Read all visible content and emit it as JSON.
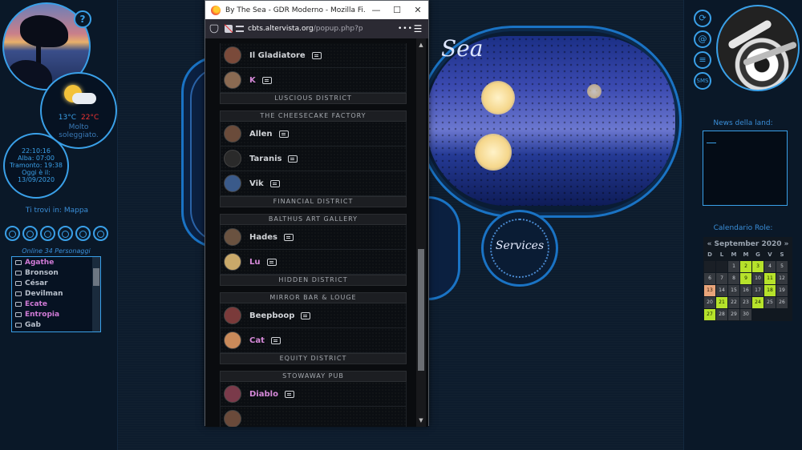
{
  "left": {
    "weather": {
      "temp_min": "13°C",
      "temp_max": "22°C",
      "description_line1": "Molto",
      "description_line2": "soleggiato."
    },
    "clock": {
      "time": "22:10:16",
      "sunrise": "Alba: 07:00",
      "sunset": "Tramonto: 19:38",
      "today_label": "Oggi è il:",
      "date": "13/09/2020"
    },
    "location": "Ti trovi in: Mappa",
    "online_title": "Online 34 Personaggi",
    "online": [
      {
        "name": "Agathe",
        "color": "pink"
      },
      {
        "name": "Bronson",
        "color": "grey"
      },
      {
        "name": "César",
        "color": "grey"
      },
      {
        "name": "Devilman",
        "color": "grey"
      },
      {
        "name": "Ecate",
        "color": "pink"
      },
      {
        "name": "Entropia",
        "color": "pink"
      },
      {
        "name": "Gab",
        "color": "grey"
      }
    ],
    "icons": [
      "map-pin-icon",
      "people-icon",
      "group-icon",
      "chat-icon",
      "mail-icon",
      "power-icon"
    ]
  },
  "right": {
    "icons": [
      "refresh-icon",
      "at-icon",
      "list-icon",
      "sms-icon"
    ],
    "sms_label": "SMS",
    "news_title": "News della land:",
    "calendar_title": "Calendario Role:",
    "calendar": {
      "header": "« September 2020 »",
      "day_names": [
        "D",
        "L",
        "M",
        "M",
        "G",
        "V",
        "S"
      ],
      "cells": [
        {
          "d": "",
          "s": "empty"
        },
        {
          "d": "",
          "s": "empty"
        },
        {
          "d": "1",
          "s": "n"
        },
        {
          "d": "2",
          "s": "green"
        },
        {
          "d": "3",
          "s": "green"
        },
        {
          "d": "4",
          "s": "n"
        },
        {
          "d": "5",
          "s": "n"
        },
        {
          "d": "6",
          "s": "n"
        },
        {
          "d": "7",
          "s": "n"
        },
        {
          "d": "8",
          "s": "n"
        },
        {
          "d": "9",
          "s": "green"
        },
        {
          "d": "10",
          "s": "n"
        },
        {
          "d": "11",
          "s": "green"
        },
        {
          "d": "12",
          "s": "n"
        },
        {
          "d": "13",
          "s": "today"
        },
        {
          "d": "14",
          "s": "n"
        },
        {
          "d": "15",
          "s": "n"
        },
        {
          "d": "16",
          "s": "n"
        },
        {
          "d": "17",
          "s": "n"
        },
        {
          "d": "18",
          "s": "green"
        },
        {
          "d": "19",
          "s": "n"
        },
        {
          "d": "20",
          "s": "n"
        },
        {
          "d": "21",
          "s": "green"
        },
        {
          "d": "22",
          "s": "n"
        },
        {
          "d": "23",
          "s": "n"
        },
        {
          "d": "24",
          "s": "green"
        },
        {
          "d": "25",
          "s": "n"
        },
        {
          "d": "26",
          "s": "n"
        },
        {
          "d": "27",
          "s": "green"
        },
        {
          "d": "28",
          "s": "n"
        },
        {
          "d": "29",
          "s": "n"
        },
        {
          "d": "30",
          "s": "n"
        },
        {
          "d": "",
          "s": "blank"
        },
        {
          "d": "",
          "s": "blank"
        },
        {
          "d": "",
          "s": "blank"
        }
      ]
    }
  },
  "center": {
    "brand_fragment": "Sea",
    "services_label": "Services"
  },
  "popup": {
    "title": "By The Sea - GDR Moderno - Mozilla Fi...",
    "url_domain": "cbts.altervista.org",
    "url_path": "/popup.php?p",
    "sections": [
      {
        "type": "rows",
        "rows": [
          {
            "name": "Il Gladiatore",
            "color": "grey",
            "avatar": "#7a4a3a"
          },
          {
            "name": "K",
            "color": "pink",
            "avatar": "#8a6a52"
          }
        ]
      },
      {
        "type": "header",
        "label": "LUSCIOUS DISTRICT"
      },
      {
        "type": "gap"
      },
      {
        "type": "header",
        "label": "THE CHEESECAKE FACTORY"
      },
      {
        "type": "rows",
        "rows": [
          {
            "name": "Allen",
            "color": "grey",
            "avatar": "#6a4b3a"
          },
          {
            "name": "Taranis",
            "color": "grey",
            "avatar": "#2a2a2a"
          },
          {
            "name": "Vik",
            "color": "grey",
            "avatar": "#3a5a8a"
          }
        ]
      },
      {
        "type": "header",
        "label": "FINANCIAL DISTRICT"
      },
      {
        "type": "gap"
      },
      {
        "type": "header",
        "label": "BALTHUS ART GALLERY"
      },
      {
        "type": "rows",
        "rows": [
          {
            "name": "Hades",
            "color": "grey",
            "avatar": "#6a5240"
          },
          {
            "name": "Lu",
            "color": "pink",
            "avatar": "#c9a96a"
          }
        ]
      },
      {
        "type": "header",
        "label": "HIDDEN DISTRICT"
      },
      {
        "type": "gap"
      },
      {
        "type": "header",
        "label": "MIRROR BAR & LOUGE"
      },
      {
        "type": "rows",
        "rows": [
          {
            "name": "Beepboop",
            "color": "grey",
            "avatar": "#7a3a3a"
          },
          {
            "name": "Cat",
            "color": "pink",
            "avatar": "#c98a5a"
          }
        ]
      },
      {
        "type": "header",
        "label": "EQUITY DISTRICT"
      },
      {
        "type": "gap"
      },
      {
        "type": "header",
        "label": "STOWAWAY PUB"
      },
      {
        "type": "rows",
        "rows": [
          {
            "name": "Diablo",
            "color": "pink",
            "avatar": "#7a3a4a"
          },
          {
            "name": "",
            "color": "grey",
            "avatar": "#6a4a3a"
          }
        ]
      }
    ]
  }
}
